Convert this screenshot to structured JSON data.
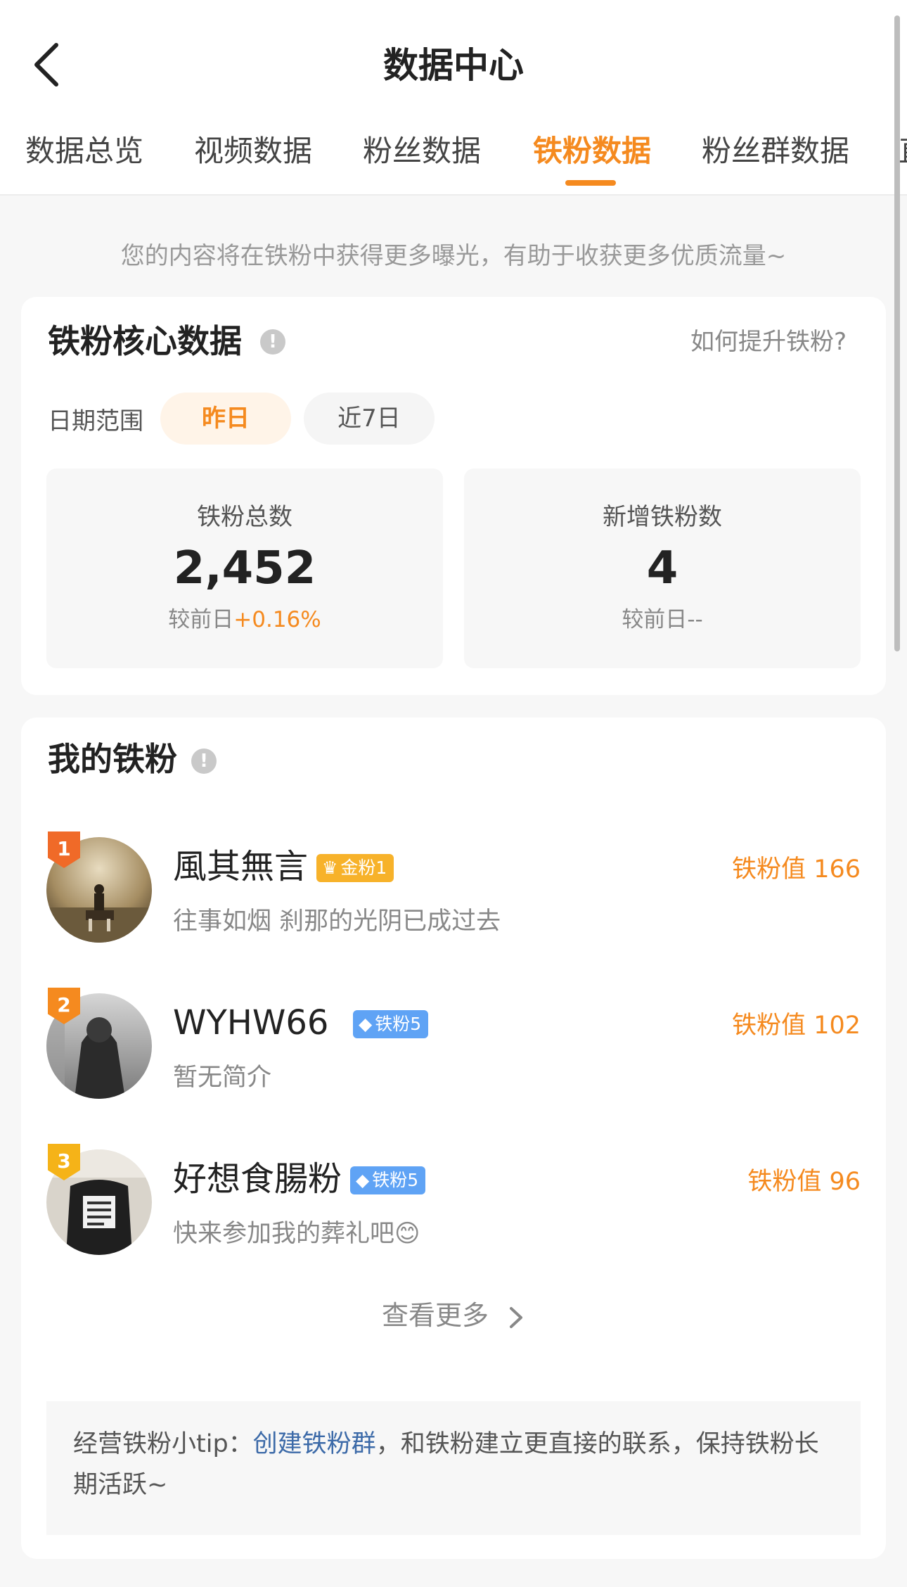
{
  "header": {
    "title": "数据中心",
    "tabs": [
      "数据总览",
      "视频数据",
      "粉丝数据",
      "铁粉数据",
      "粉丝群数据",
      "直"
    ],
    "active_tab": "铁粉数据"
  },
  "notice": "您的内容将在铁粉中获得更多曝光，有助于收获更多优质流量~",
  "core": {
    "title": "铁粉核心数据",
    "info_glyph": "!",
    "help_link": "如何提升铁粉?",
    "date_label": "日期范围",
    "chips": [
      "昨日",
      "近7日"
    ],
    "selected_chip": "昨日",
    "stats": [
      {
        "label": "铁粉总数",
        "value": "2,452",
        "compare_prefix": "较前日",
        "compare_value": "+0.16%"
      },
      {
        "label": "新增铁粉数",
        "value": "4",
        "compare_prefix": "较前日",
        "compare_value": "--"
      }
    ]
  },
  "fans": {
    "title": "我的铁粉",
    "info_glyph": "!",
    "list": [
      {
        "rank": "1",
        "name": "風其無言",
        "tag": "金粉1",
        "tag_color": "#f7b22a",
        "bio": "往事如烟 刹那的光阴已成过去",
        "value": "铁粉值 166"
      },
      {
        "rank": "2",
        "name": "WYHW66",
        "tag": "铁粉5",
        "tag_color": "#5fa3f5",
        "bio": "暂无简介",
        "value": "铁粉值 102"
      },
      {
        "rank": "3",
        "name": "好想食腸粉",
        "tag": "铁粉5",
        "tag_color": "#5fa3f5",
        "bio": "快来参加我的葬礼吧😊",
        "value": "铁粉值 96"
      }
    ],
    "more": "查看更多",
    "tip_prefix": "经营铁粉小tip：",
    "tip_link": "创建铁粉群",
    "tip_suffix": "，和铁粉建立更直接的联系，保持铁粉长期活跃~"
  },
  "colors": {
    "accent": "#f58a1f",
    "link": "#3c6aa8"
  },
  "icons": {
    "back": "chevron-left-icon",
    "more_arrow": "chevron-right-icon",
    "info": "info-icon",
    "gold_tag": "crown-icon",
    "blue_tag": "diamond-icon"
  }
}
